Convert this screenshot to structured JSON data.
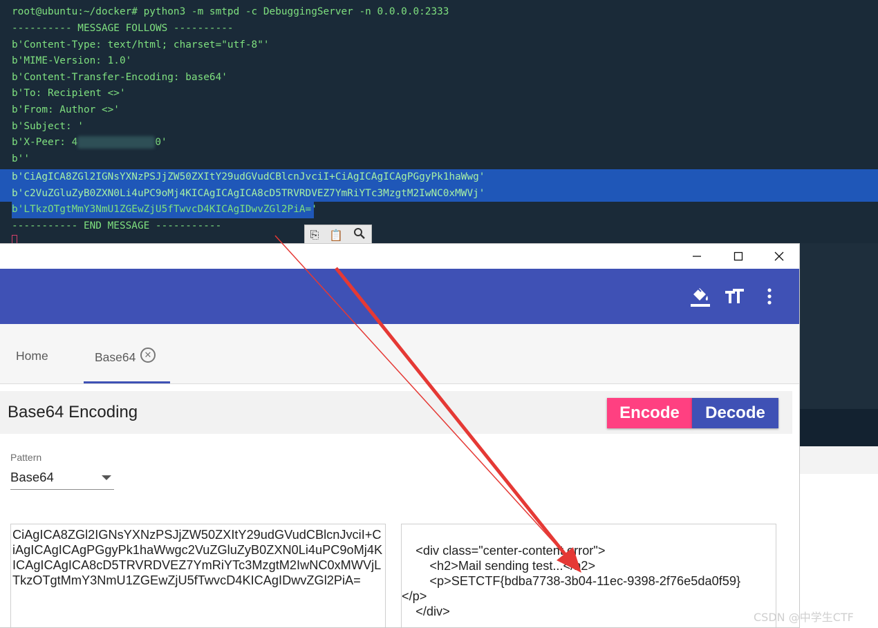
{
  "terminal": {
    "lines": [
      "root@ubuntu:~/docker# python3 -m smtpd -c DebuggingServer -n 0.0.0.0:2333",
      "---------- MESSAGE FOLLOWS ----------",
      "b'Content-Type: text/html; charset=\"utf-8\"'",
      "b'MIME-Version: 1.0'",
      "b'Content-Transfer-Encoding: base64'",
      "b'To: Recipient <>'",
      "b'From: Author <>'",
      "b'Subject: '",
      "b''",
      "b'CiAgICA8ZGl2IGNsYXNzPSJjZW50ZXItY29udGVudCBlcnJvciI+CiAgICAgICAgPGgyPk1haWwg'",
      "b'c2VuZGluZyB0ZXN0Li4uPC9oMj4KICAgICAgICA8cD5TRVRDVEZ7YmRiYTc3MzgtM2IwNC0xMWVj'",
      "b'LTkzOTgtMmY3NmU1ZGEwZjU5fTwvcD4KICAgIDwvZGl2PiA='",
      "----------- END MESSAGE -----------"
    ],
    "xpeer_prefix": "b'X-Peer: 4",
    "xpeer_suffix": "0'",
    "toolbar_icons": [
      "copy-icon",
      "paste-icon",
      "search-icon"
    ]
  },
  "window": {
    "controls": [
      "minimize",
      "maximize",
      "close"
    ],
    "control_glyphs": {
      "minimize": "—",
      "maximize": "☐",
      "close": "✕"
    },
    "appbar_icons": [
      "format-color-fill-icon",
      "text-size-icon",
      "more-vert-icon"
    ],
    "colors": {
      "appbar": "#3f51b5",
      "encode": "#ff4081",
      "decode": "#3f51b5"
    }
  },
  "tabs": [
    {
      "label": "Home",
      "active": false
    },
    {
      "label": "Base64",
      "active": true,
      "closable": true
    }
  ],
  "section": {
    "title": "Base64 Encoding",
    "encode_label": "Encode",
    "decode_label": "Decode"
  },
  "pattern": {
    "label": "Pattern",
    "value": "Base64"
  },
  "input_text": "CiAgICA8ZGl2IGNsYXNzPSJjZW50ZXItY29udGVudCBlcnJvciI+CiAgICAgICAgPGgyPk1haWwgc2VuZGluZyB0ZXN0Li4uPC9oMj4KICAgICAgICA8cD5TRVRDVEZ7YmRiYTc3MzgtM2IwNC0xMWVjLTkzOTgtMmY3NmU1ZGEwZjU5fTwvcD4KICAgIDwvZGl2PiA=",
  "output_text": "    <div class=\"center-content error\">\n        <h2>Mail sending test...</h2>\n        <p>SETCTF{bdba7738-3b04-11ec-9398-2f76e5da0f59}\n</p>\n    </div>",
  "watermark": "CSDN @中学生CTF"
}
